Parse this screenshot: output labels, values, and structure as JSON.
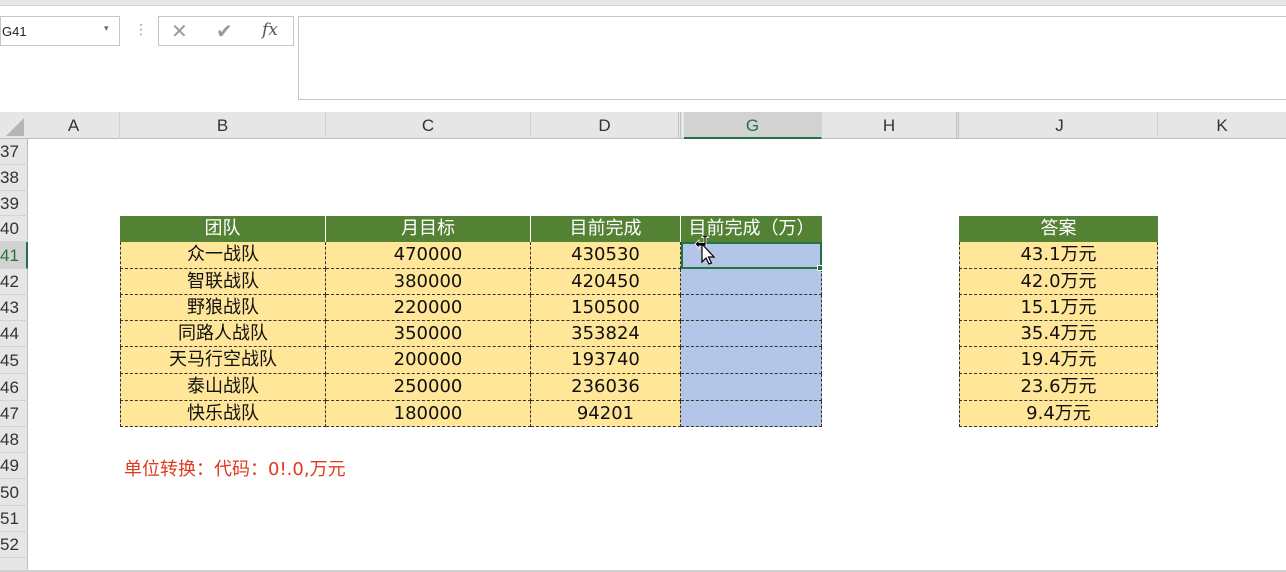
{
  "formula_bar": {
    "name_box": "G41",
    "fx": "fx",
    "cancel_glyph": "✕",
    "confirm_glyph": "✔",
    "dots": "⋮",
    "dropdown_glyph": "▾",
    "formula": ""
  },
  "columns": [
    "A",
    "B",
    "C",
    "D",
    "G",
    "H",
    "J",
    "K"
  ],
  "active_column": "G",
  "rows": [
    "37",
    "38",
    "39",
    "40",
    "41",
    "42",
    "43",
    "44",
    "45",
    "46",
    "47",
    "48",
    "49",
    "50",
    "51",
    "52"
  ],
  "active_row": "41",
  "table": {
    "headers": [
      "团队",
      "月目标",
      "目前完成",
      "目前完成（万）"
    ],
    "rows": [
      {
        "team": "众一战队",
        "target": "470000",
        "done": "430530",
        "done_wan": ""
      },
      {
        "team": "智联战队",
        "target": "380000",
        "done": "420450",
        "done_wan": ""
      },
      {
        "team": "野狼战队",
        "target": "220000",
        "done": "150500",
        "done_wan": ""
      },
      {
        "team": "同路人战队",
        "target": "350000",
        "done": "353824",
        "done_wan": ""
      },
      {
        "team": "天马行空战队",
        "target": "200000",
        "done": "193740",
        "done_wan": ""
      },
      {
        "team": "泰山战队",
        "target": "250000",
        "done": "236036",
        "done_wan": ""
      },
      {
        "team": "快乐战队",
        "target": "180000",
        "done": "94201",
        "done_wan": ""
      }
    ]
  },
  "answer": {
    "header": "答案",
    "values": [
      "43.1万元",
      "42.0万元",
      "15.1万元",
      "35.4万元",
      "19.4万元",
      "23.6万元",
      "9.4万元"
    ]
  },
  "note": "单位转换：代码：0!.0,万元",
  "colors": {
    "header_green": "#548235",
    "cell_yellow": "#ffe699",
    "selection_blue": "#b4c6e7",
    "excel_green": "#217346",
    "note_red": "#e03a1e"
  },
  "icons": [
    "dropdown-icon",
    "cancel-icon",
    "confirm-icon",
    "function-icon",
    "mouse-cursor-icon"
  ]
}
